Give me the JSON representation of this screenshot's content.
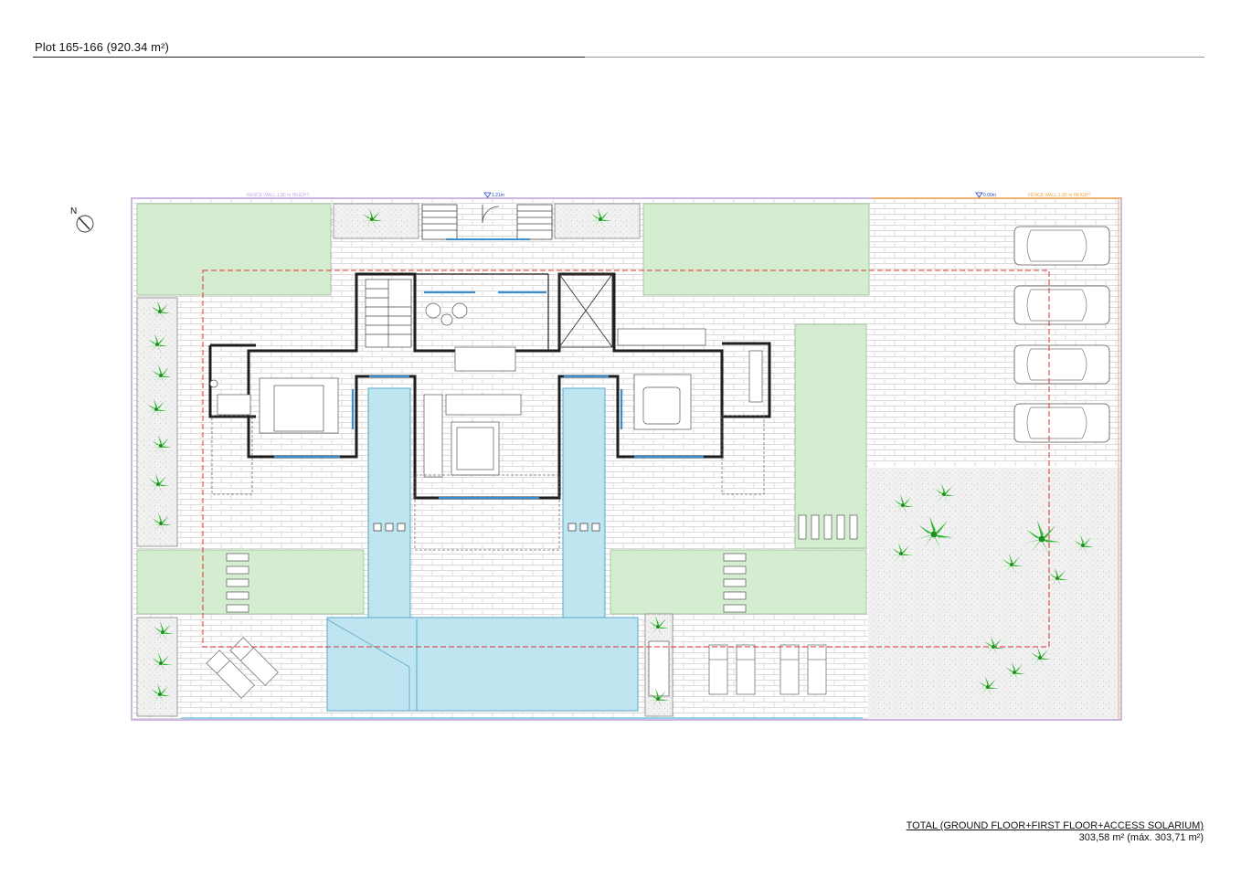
{
  "header": {
    "title": "Plot 165-166 (920.34 m²)"
  },
  "plan": {
    "north_label": "N",
    "fence_label_left": "FENCE WALL 1.80 m HEIGHT",
    "fence_label_right": "FENCE WALL 1.80 m HEIGHT",
    "level_center": "1.21m",
    "level_right": "0.00m",
    "colors": {
      "lawn": "#d4edd0",
      "pool": "#bfe6f0",
      "paving_line": "#c8c8c8",
      "wall": "#222222",
      "setback": "#e03030",
      "plant": "#22bb22",
      "fence_left": "#c9a8e8",
      "fence_right": "#f2a64a"
    }
  },
  "footer": {
    "total_label": "TOTAL (GROUND FLOOR+FIRST FLOOR+ACCESS SOLARIUM)",
    "total_value": "303,58 m² (máx. 303,71 m²)"
  }
}
